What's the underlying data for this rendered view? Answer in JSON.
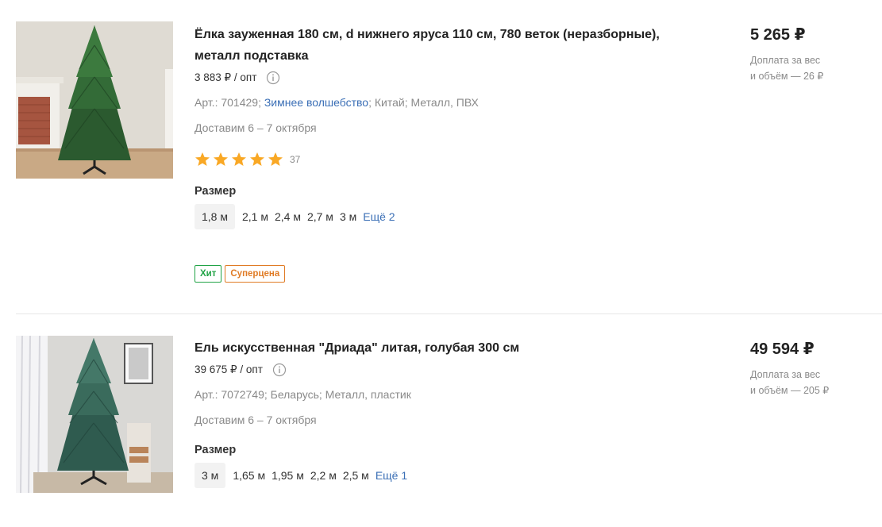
{
  "products": [
    {
      "title": "Ёлка зауженная 180 см, d нижнего яруса 110 см, 780 веток (неразборные), металл подставка",
      "wholesale_price": "3 883 ₽ / опт",
      "article_prefix": "Арт.: 701429; ",
      "brand": "Зимнее волшебство",
      "article_suffix": "; Китай; Металл, ПВХ",
      "delivery": "Доставим 6 – 7 октября",
      "rating": 5,
      "rating_count": "37",
      "size_label": "Размер",
      "sizes": [
        "1,8 м",
        "2,1 м",
        "2,4 м",
        "2,7 м",
        "3 м"
      ],
      "selected_size": "1,8 м",
      "more_sizes": "Ещё 2",
      "badges": [
        "Хит",
        "Суперцена"
      ],
      "price": "5 265 ₽",
      "surcharge_line1": "Доплата за вес",
      "surcharge_line2": "и объём — 26 ₽"
    },
    {
      "title": "Ель искусственная \"Дриада\" литая, голубая 300 см",
      "wholesale_price": "39 675 ₽ / опт",
      "article": "Арт.: 7072749; Беларусь; Металл, пластик",
      "delivery": "Доставим 6 – 7 октября",
      "size_label": "Размер",
      "sizes": [
        "3 м",
        "1,65 м",
        "1,95 м",
        "2,2 м",
        "2,5 м"
      ],
      "selected_size": "3 м",
      "more_sizes": "Ещё 1",
      "price": "49 594 ₽",
      "surcharge_line1": "Доплата за вес",
      "surcharge_line2": "и объём — 205 ₽"
    }
  ],
  "colors": {
    "accent_link": "#3b6fb6",
    "star": "#f9a825",
    "badge_hit": "#21a346",
    "badge_super": "#e07b25"
  },
  "icons": [
    "info-icon",
    "star-icon"
  ]
}
